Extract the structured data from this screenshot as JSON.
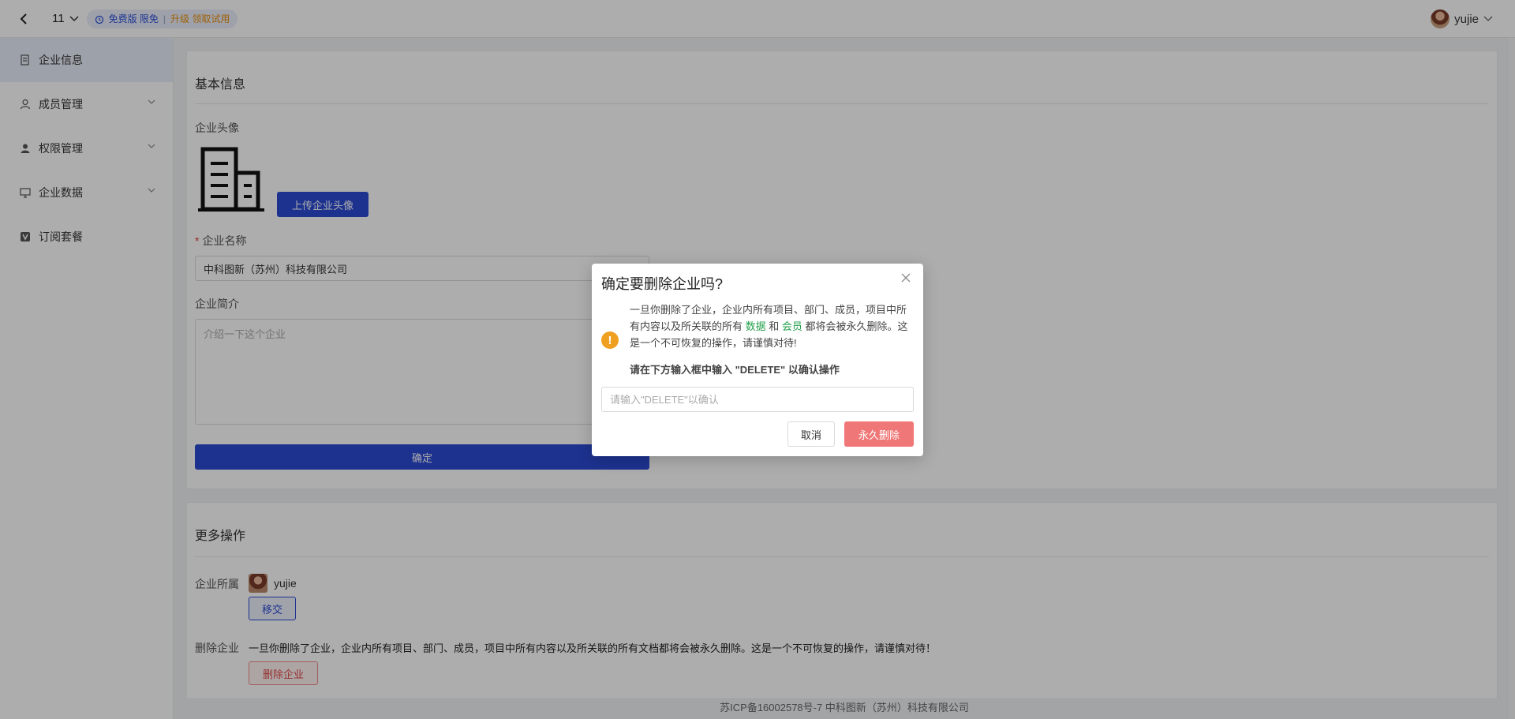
{
  "topbar": {
    "workspace_name": "11",
    "plan_free": "免费版 限免",
    "plan_separator": "|",
    "plan_upgrade": "升级 领取试用",
    "username": "yujie"
  },
  "sidebar": {
    "items": [
      {
        "label": "企业信息",
        "icon": "document-icon",
        "active": true
      },
      {
        "label": "成员管理",
        "icon": "user-icon",
        "expandable": true
      },
      {
        "label": "权限管理",
        "icon": "user-solid-icon",
        "expandable": true
      },
      {
        "label": "企业数据",
        "icon": "monitor-icon",
        "expandable": true
      },
      {
        "label": "订阅套餐",
        "icon": "v-badge-icon"
      }
    ]
  },
  "basic_info": {
    "title": "基本信息",
    "avatar_label": "企业头像",
    "upload_button": "上传企业头像",
    "name_label": "企业名称",
    "name_required_mark": "*",
    "name_value": "中科图新（苏州）科技有限公司",
    "intro_label": "企业简介",
    "intro_placeholder": "介绍一下这个企业",
    "submit_button": "确定"
  },
  "more_ops": {
    "title": "更多操作",
    "owner_label": "企业所属",
    "owner_name": "yujie",
    "transfer_button": "移交",
    "delete_label": "删除企业",
    "delete_warning": "一旦你删除了企业，企业内所有项目、部门、成员，项目中所有内容以及所关联的所有文档都将会被永久删除。这是一个不可恢复的操作，请谨慎对待！",
    "delete_button": "删除企业"
  },
  "footer": {
    "text": "苏ICP备16002578号-7 中科图新（苏州）科技有限公司"
  },
  "modal": {
    "title": "确定要删除企业吗?",
    "msg_part1": "一旦你删除了企业，企业内所有项目、部门、成员，项目中所有内容以及所关联的所有 ",
    "msg_highlight1": "数据",
    "msg_and": " 和 ",
    "msg_highlight2": "会员",
    "msg_part2": " 都将会被永久删除。这是一个不可恢复的操作，请谨慎对待!",
    "hint": "请在下方输入框中输入 \"DELETE\" 以确认操作",
    "input_placeholder": "请输入\"DELETE\"以确认",
    "cancel_button": "取消",
    "confirm_button": "永久删除"
  },
  "colors": {
    "primary": "#2b4ad3",
    "danger": "#f07777",
    "warning": "#f0a020",
    "highlight_green": "#22a04a"
  }
}
